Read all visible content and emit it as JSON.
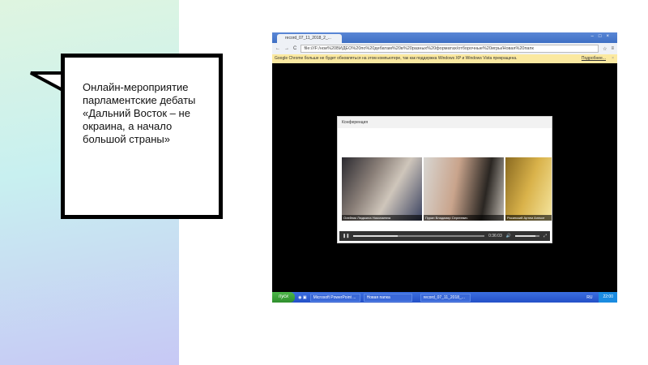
{
  "slide": {
    "callout_text": "Онлайн-мероприятие парламентские дебаты «Дальний Восток – не окраина, а начало большой страны»"
  },
  "browser": {
    "tab_title": "record_07_11_2018_2_...",
    "url": "file:///F:/нои%20ВИДЕО%20по%20дебатам%20в%20разных%20форматах/отборочные%20игры/Новая%20папк",
    "infobar_text": "Google Chrome больше не будет обновляться на этом компьютере, так как поддержка Windows XP и Windows Vista прекращена.",
    "infobar_link": "Подробнее..."
  },
  "conference": {
    "title": "Конференция",
    "participants": [
      {
        "name": "Олейник Людмила Николаевна"
      },
      {
        "name": "Пуран Владимир Сергеевич"
      },
      {
        "name": "Рясинский Артем Алексе"
      }
    ],
    "player": {
      "time": "0:36:03",
      "progress": 0.34,
      "volume": 0.85
    }
  },
  "taskbar": {
    "start": "пуск",
    "items": [
      "Microsoft PowerPoint ...",
      "Новая папка",
      "record_07_11_2018_..."
    ],
    "lang": "RU",
    "clock": "22:00"
  }
}
